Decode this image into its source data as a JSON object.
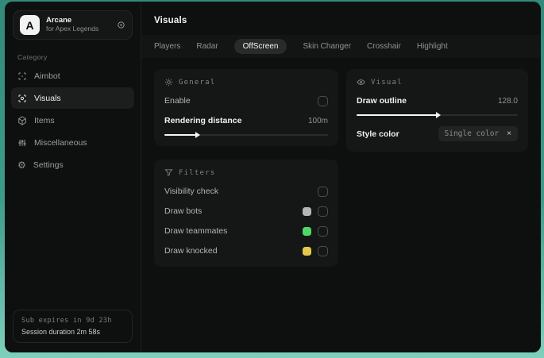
{
  "sidebar": {
    "logo": {
      "letter": "A",
      "name": "Arcane",
      "subtitle": "for Apex Legends"
    },
    "category_label": "Category",
    "items": [
      {
        "label": "Aimbot",
        "icon": "crosshair-icon",
        "active": false
      },
      {
        "label": "Visuals",
        "icon": "eye-scan-icon",
        "active": true
      },
      {
        "label": "Items",
        "icon": "cube-icon",
        "active": false
      },
      {
        "label": "Miscellaneous",
        "icon": "sliders-icon",
        "active": false
      },
      {
        "label": "Settings",
        "icon": "gear-icon",
        "active": false
      }
    ],
    "footer": {
      "line1": "Sub expires in 9d 23h",
      "line2": "Session duration 2m 58s"
    }
  },
  "main": {
    "title": "Visuals",
    "tabs": [
      {
        "label": "Players",
        "active": false
      },
      {
        "label": "Radar",
        "active": false
      },
      {
        "label": "OffScreen",
        "active": true
      },
      {
        "label": "Skin Changer",
        "active": false
      },
      {
        "label": "Crosshair",
        "active": false
      },
      {
        "label": "Highlight",
        "active": false
      }
    ],
    "panels": {
      "general": {
        "title": "General",
        "enable_label": "Enable",
        "enable_checked": false,
        "rendering_label": "Rendering distance",
        "rendering_value": "100m",
        "rendering_percent": 20
      },
      "visual": {
        "title": "Visual",
        "outline_label": "Draw outline",
        "outline_value": "128.0",
        "outline_percent": 50,
        "style_label": "Style color",
        "style_value": "Single color",
        "style_clear": "×"
      },
      "filters": {
        "title": "Filters",
        "rows": [
          {
            "label": "Visibility check",
            "swatch": null,
            "checked": false
          },
          {
            "label": "Draw bots",
            "swatch": "#b5b5b3",
            "checked": false
          },
          {
            "label": "Draw teammates",
            "swatch": "#4cd964",
            "checked": false
          },
          {
            "label": "Draw knocked",
            "swatch": "#e4c94d",
            "checked": false
          }
        ]
      }
    }
  },
  "colors": {
    "accent_teal": "#3d9c89",
    "window_bg": "#0d0f0f",
    "panel_bg": "#151717",
    "swatch_gray": "#b5b5b3",
    "swatch_green": "#4cd964",
    "swatch_yellow": "#e4c94d"
  }
}
